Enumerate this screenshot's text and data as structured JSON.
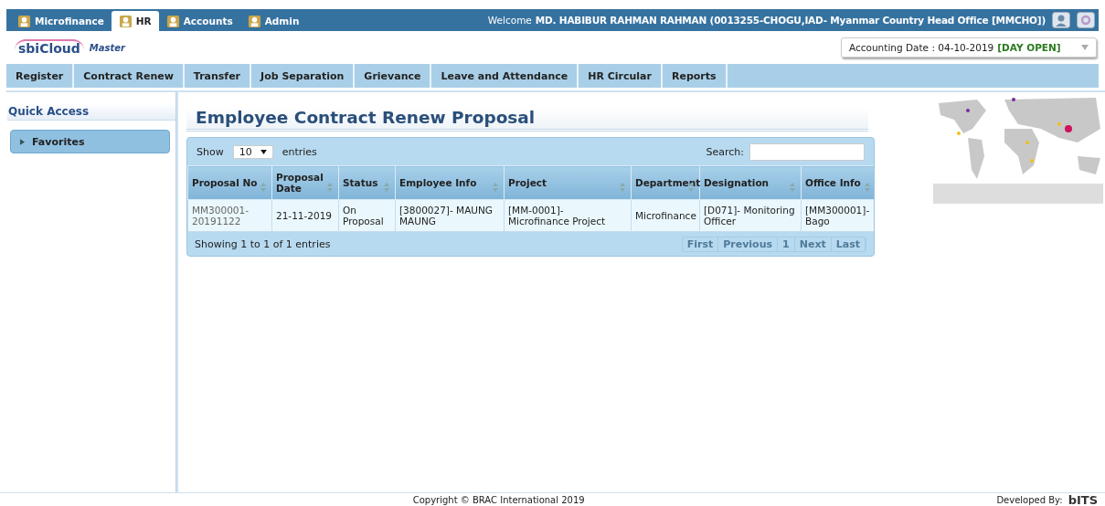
{
  "top_tabs": [
    {
      "label": "Microfinance",
      "selected": false
    },
    {
      "label": "HR",
      "selected": true
    },
    {
      "label": "Accounts",
      "selected": false
    },
    {
      "label": "Admin",
      "selected": false
    }
  ],
  "welcome": {
    "prefix": "Welcome",
    "user": "MD. HABIBUR RAHMAN RAHMAN (0013255-CHOGU,IAD- Myanmar Country Head Office [MMCHO])"
  },
  "logo": {
    "name": "sbiCloud",
    "edition": "Master"
  },
  "accounting": {
    "label": "Accounting Date : 04-10-2019",
    "status": "[DAY OPEN]"
  },
  "menu": [
    "Register",
    "Contract Renew",
    "Transfer",
    "Job Separation",
    "Grievance",
    "Leave and Attendance",
    "HR Circular",
    "Reports"
  ],
  "sidebar": {
    "title": "Quick Access",
    "items": [
      {
        "label": "Favorites",
        "expanded": false
      }
    ]
  },
  "page_title": "Employee Contract Renew Proposal",
  "table": {
    "show_label": "Show",
    "page_size": "10",
    "entries_label": "entries",
    "search_label": "Search:",
    "columns": [
      "Proposal No",
      "Proposal Date",
      "Status",
      "Employee Info",
      "Project",
      "Department",
      "Designation",
      "Office Info"
    ],
    "rows": [
      [
        "MM300001-20191122",
        "21-11-2019",
        "On Proposal",
        "[3800027]- MAUNG MAUNG",
        "[MM-0001]- Microfinance Project",
        "Microfinance",
        "[D071]- Monitoring Officer",
        "[MM300001]- Bago"
      ]
    ],
    "info": "Showing 1 to 1 of 1 entries",
    "pagination": [
      {
        "label": "First",
        "disabled": true
      },
      {
        "label": "Previous",
        "disabled": true
      },
      {
        "label": "1",
        "disabled": true
      },
      {
        "label": "Next",
        "disabled": true
      },
      {
        "label": "Last",
        "disabled": true
      }
    ]
  },
  "footer": {
    "copyright": "Copyright © BRAC International 2019",
    "developed_by": "Developed By:",
    "developer": "bITS"
  }
}
